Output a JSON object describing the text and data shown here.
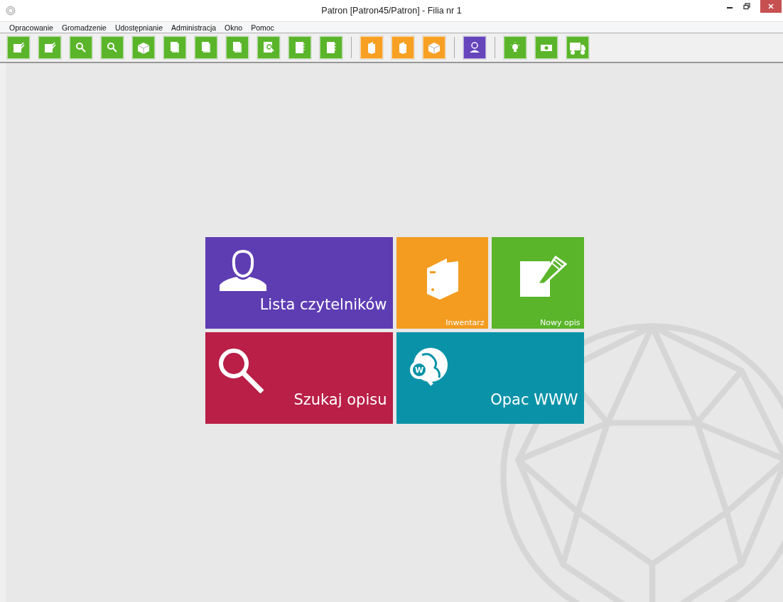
{
  "window": {
    "title": "Patron [Patron45/Patron] - Filia nr 1"
  },
  "menu": [
    "Opracowanie",
    "Gromadzenie",
    "Udostępnianie",
    "Administracja",
    "Okno",
    "Pomoc"
  ],
  "toolbar": [
    {
      "color": "#5ab52a",
      "buttons": [
        {
          "kind": "note"
        },
        {
          "kind": "note"
        },
        {
          "kind": "search"
        },
        {
          "kind": "search"
        },
        {
          "kind": "box"
        },
        {
          "kind": "pages"
        },
        {
          "kind": "pages"
        },
        {
          "kind": "pages"
        },
        {
          "kind": "docsearch"
        },
        {
          "kind": "notebook"
        },
        {
          "kind": "notebook"
        }
      ]
    },
    {
      "color": "#f7a023",
      "buttons": [
        {
          "kind": "binder"
        },
        {
          "kind": "binder"
        },
        {
          "kind": "box"
        }
      ]
    },
    {
      "color": "#6644bb",
      "buttons": [
        {
          "kind": "person"
        }
      ]
    },
    {
      "color": "#5ab52a",
      "buttons": [
        {
          "kind": "bulb"
        },
        {
          "kind": "money"
        },
        {
          "kind": "truck"
        }
      ]
    }
  ],
  "tiles": [
    {
      "label": "Lista czytelników",
      "kind": "person",
      "color": "#5e3db3"
    },
    {
      "label": "Inwentarz",
      "kind": "binder",
      "color": "#f39c20"
    },
    {
      "label": "Nowy opis",
      "kind": "note",
      "color": "#5ab52a"
    },
    {
      "label": "Szukaj opisu",
      "kind": "search",
      "color": "#b91f47"
    },
    {
      "label": "Opac WWW",
      "kind": "globe",
      "color": "#0a93a8",
      "icon_letter": "W"
    }
  ]
}
